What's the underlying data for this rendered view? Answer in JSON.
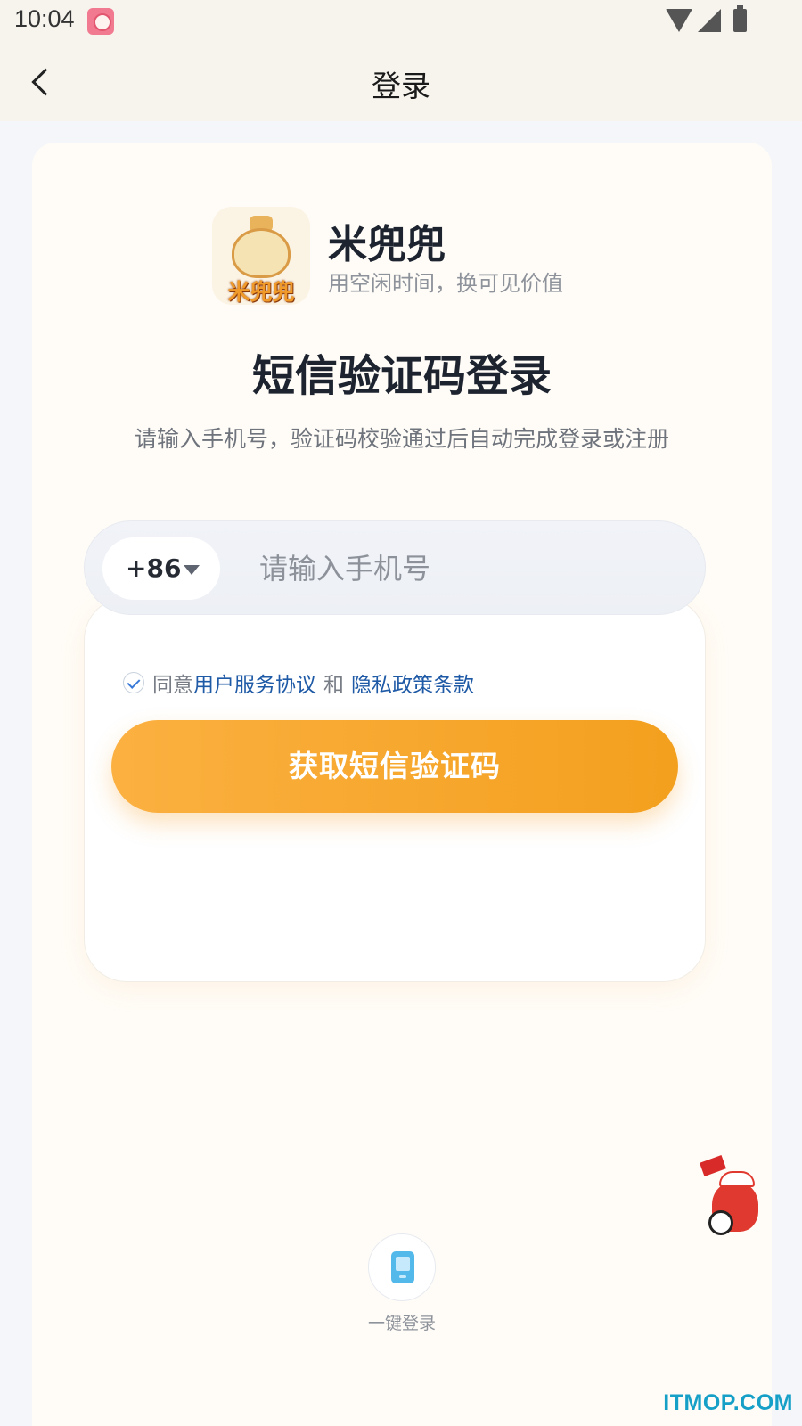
{
  "status_bar": {
    "time": "10:04",
    "notification_icon": "app-notification-icon",
    "wifi_icon": "wifi-icon",
    "signal_icon": "signal-icon",
    "battery_icon": "battery-charging-icon"
  },
  "header": {
    "title": "登录",
    "back_icon": "chevron-left-icon"
  },
  "brand": {
    "logo_text": "米兜兜",
    "name": "米兜兜",
    "slogan": "用空闲时间，换可见价值"
  },
  "login": {
    "heading": "短信验证码登录",
    "subheading": "请输入手机号，验证码校验通过后自动完成登录或注册",
    "country_code": "+86",
    "phone_placeholder": "请输入手机号",
    "phone_value": "",
    "agreement": {
      "checked": true,
      "prefix": "同意",
      "terms_link": "用户服务协议",
      "and": "和",
      "privacy_link": "隐私政策条款"
    },
    "submit_label": "获取短信验证码"
  },
  "alt_login": {
    "icon": "mobile-phone-icon",
    "label": "一键登录"
  },
  "mascot_icon": "red-mascot-soccer-icon",
  "watermark": "ITMOP.COM",
  "colors": {
    "accent_orange": "#f3a01e",
    "link_blue": "#1f5aa6",
    "header_bg": "#f7f4ee"
  }
}
